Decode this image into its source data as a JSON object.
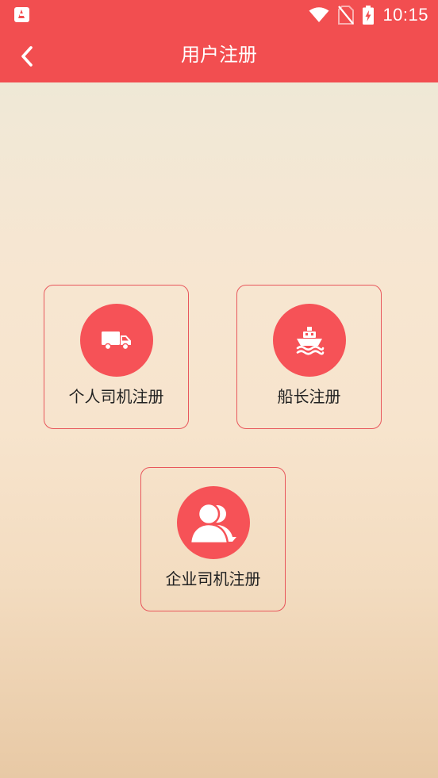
{
  "status_bar": {
    "time": "10:15",
    "icons": [
      "app-notification-icon",
      "wifi-icon",
      "no-sim-icon",
      "battery-charging-icon"
    ]
  },
  "nav": {
    "back_icon": "chevron-left-icon",
    "title": "用户注册"
  },
  "options": [
    {
      "label": "个人司机注册",
      "icon": "truck-icon"
    },
    {
      "label": "船长注册",
      "icon": "ship-icon"
    },
    {
      "label": "企业司机注册",
      "icon": "users-icon"
    }
  ],
  "colors": {
    "primary": "#F24E50",
    "icon_circle": "#F65257",
    "card_border": "#E8575C"
  }
}
